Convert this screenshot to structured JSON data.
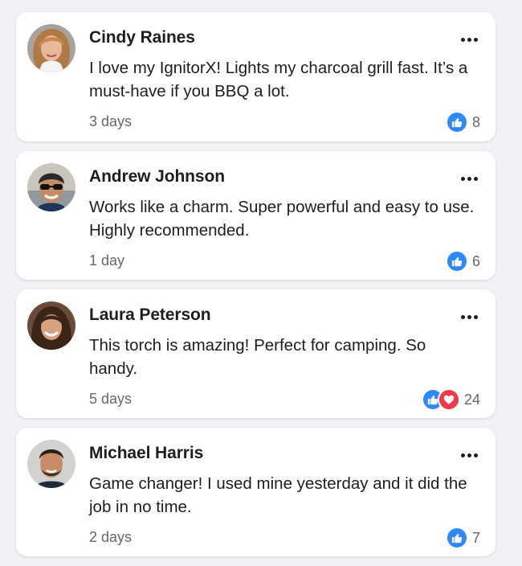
{
  "colors": {
    "like": "#2e89ff",
    "love": "#f0384b",
    "meta_text": "#65676b",
    "background": "#f0f2f5"
  },
  "comments": [
    {
      "author": "Cindy Raines",
      "text": "I love my IgnitorX! Lights my charcoal grill fast. It’s a must-have if you BBQ a lot.",
      "time": "3 days",
      "reactions": [
        "like-icon"
      ],
      "count": "8"
    },
    {
      "author": "Andrew Johnson",
      "text": "Works like a charm. Super powerful and easy to use. Highly recommended.",
      "time": "1 day",
      "reactions": [
        "like-icon"
      ],
      "count": "6"
    },
    {
      "author": "Laura Peterson",
      "text": "This torch is amazing! Perfect for camping. So handy.",
      "time": "5 days",
      "reactions": [
        "like-icon",
        "love-icon"
      ],
      "count": "24"
    },
    {
      "author": "Michael Harris",
      "text": "Game changer! I used mine yesterday and it did the job in no time.",
      "time": "2 days",
      "reactions": [
        "like-icon"
      ],
      "count": "7"
    }
  ]
}
